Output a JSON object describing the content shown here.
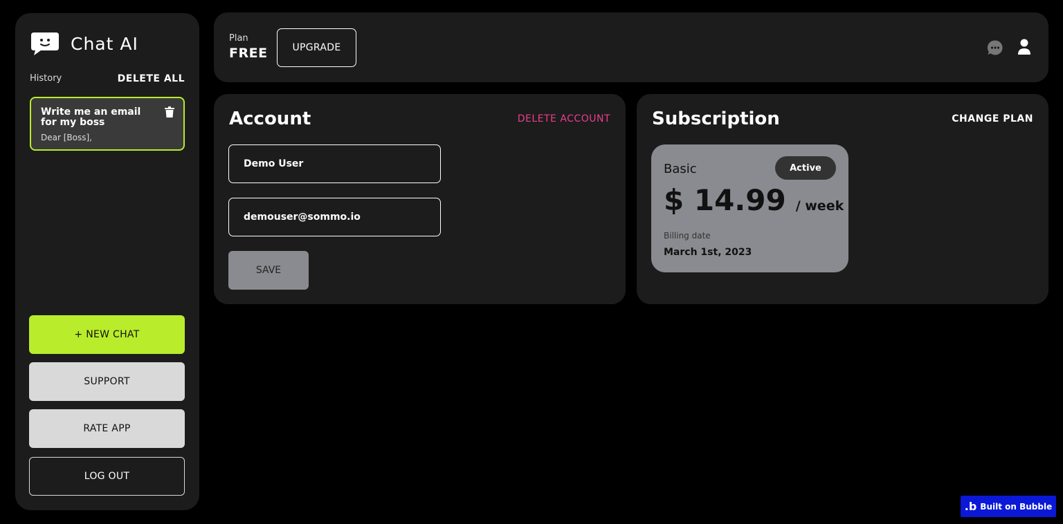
{
  "sidebar": {
    "brand_name": "Chat AI",
    "history_label": "History",
    "delete_all_label": "DELETE ALL",
    "history_items": [
      {
        "title": "Write me an email for my boss",
        "preview": "Dear [Boss],"
      }
    ],
    "buttons": {
      "new_chat": "+ NEW CHAT",
      "support": "SUPPORT",
      "rate_app": "RATE APP",
      "log_out": "LOG OUT"
    }
  },
  "topbar": {
    "plan_label": "Plan",
    "plan_value": "FREE",
    "upgrade_label": "UPGRADE"
  },
  "account": {
    "title": "Account",
    "delete_label": "DELETE ACCOUNT",
    "name_value": "Demo User",
    "email_value": "demouser@sommo.io",
    "save_label": "SAVE"
  },
  "subscription": {
    "title": "Subscription",
    "change_plan_label": "CHANGE PLAN",
    "plan_name": "Basic",
    "status": "Active",
    "price": "$ 14.99",
    "period": "/ week",
    "billing_label": "Billing date",
    "billing_date": "March 1st, 2023"
  },
  "badge": {
    "logo": ".b",
    "label": "Built on Bubble"
  },
  "colors": {
    "accent": "#b9ec2a",
    "danger": "#e93f8a",
    "panel": "#1c1c1c",
    "background": "#000000",
    "bubble": "#0b19d6"
  },
  "icons": {
    "logo": "chat-bubble-face-icon",
    "trash": "trash-icon",
    "chat": "chat-bubble-dots-icon",
    "user": "user-icon"
  }
}
